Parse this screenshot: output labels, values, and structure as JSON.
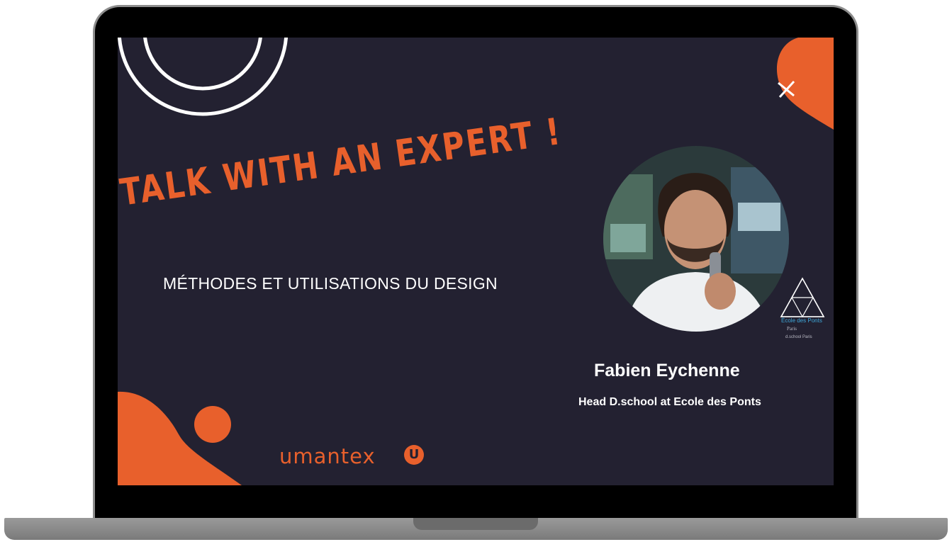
{
  "slide": {
    "headline": "TALK WITH AN EXPERT !",
    "subtitle": "MÉTHODES ET UTILISATIONS DU DESIGN",
    "speaker_name": "Fabien Eychenne",
    "speaker_role": "Head D.school at Ecole des Ponts",
    "brand_name": "umantex",
    "brand_mark": "U",
    "school_name": "École des Ponts",
    "school_city": "Paris",
    "school_dschool": "d.school Paris"
  },
  "icons": {
    "close": "close-icon",
    "brand_logo": "umantex-logo-icon",
    "school_logo": "triangle-logo-icon"
  },
  "colors": {
    "background": "#232131",
    "accent": "#e8602c",
    "text": "#ffffff",
    "school_blue": "#3fa6d8"
  }
}
